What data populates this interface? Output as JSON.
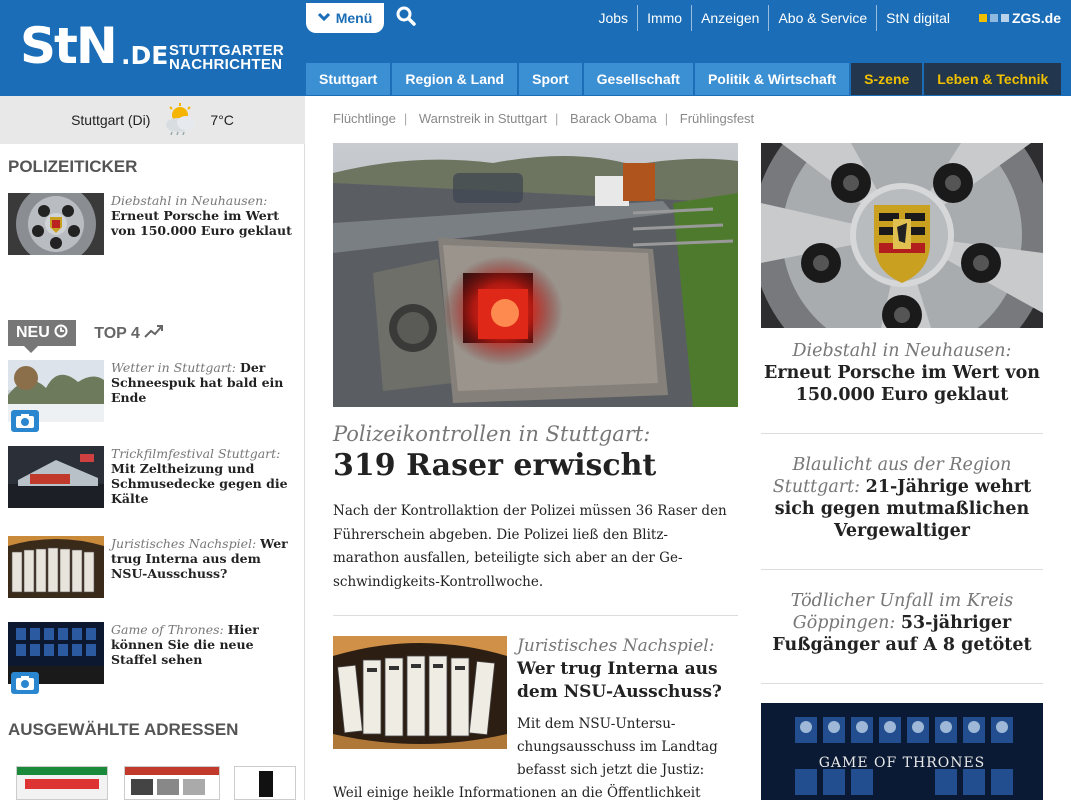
{
  "header": {
    "logo_main": "StN",
    "logo_domain": ".DE",
    "logo_sub_line1": "STUTTGARTER",
    "logo_sub_line2": "NACHRICHTEN",
    "menu_label": "Menü",
    "top_links": [
      "Jobs",
      "Immo",
      "Anzeigen",
      "Abo & Service",
      "StN digital"
    ],
    "zgs_label": "ZGS.de",
    "nav_items": [
      "Stuttgart",
      "Region & Land",
      "Sport",
      "Gesellschaft",
      "Politik & Wirtschaft",
      "S-zene",
      "Leben & Technik"
    ]
  },
  "colors": {
    "brand_blue": "#1a6db6",
    "nav_blue": "#3b8fd3",
    "nav_dark": "#22364e",
    "nav_yellow": "#f0c000"
  },
  "weather": {
    "city": "Stuttgart (Di)",
    "temp": "7°C",
    "icon": "sun-cloud-icon"
  },
  "left": {
    "polizei_title": "POLIZEITICKER",
    "polizei_item": {
      "kicker": "Diebstahl in Neuhausen:",
      "headline": "Erneut Porsche im Wert von 150.000 Euro geklaut"
    },
    "tab_neu": "NEU",
    "tab_top": "TOP 4",
    "list": [
      {
        "kicker": "Wetter in Stuttgart:",
        "headline": "Der Schneespuk hat bald ein Ende",
        "camera": true
      },
      {
        "kicker": "Trickfilmfestival Stuttgart:",
        "headline": "Mit Zeltheizung und Schmusedecke gegen die Kälte",
        "camera": false
      },
      {
        "kicker": "Juristisches Nachspiel:",
        "headline": "Wer trug Interna aus dem NSU-Ausschuss?",
        "camera": false
      },
      {
        "kicker": "Game of Thrones:",
        "headline": "Hier können Sie die neue Staffel sehen",
        "camera": true
      }
    ],
    "adressen_title": "AUSGEWÄHLTE ADRESSEN"
  },
  "middle": {
    "tags": [
      "Flüchtlinge",
      "Warnstreik in Stuttgart",
      "Barack Obama",
      "Frühlingsfest"
    ],
    "hero_kicker": "Polizeikontrollen in Stuttgart:",
    "hero_title": "319 Raser erwischt",
    "hero_teaser": "Nach der Kontrollaktion der Polizei müssen 36 Raser den Führerschein abgeben. Die Polizei ließ den Blitz-marathon ausfallen, beteiligte sich aber an der Ge-schwindigkeits-Kontrollwoche.",
    "second_kicker": "Juristisches Nachspiel:",
    "second_title": "Wer trug Interna aus dem NSU-Ausschuss?",
    "second_teaser_l1": "Mit dem NSU-Untersu-",
    "second_teaser_l2": "chungsausschuss im Landtag",
    "second_teaser_l3": "befasst sich jetzt die Justiz:",
    "second_teaser_l4": "Weil einige heikle Informationen an die Öffentlichkeit"
  },
  "right": {
    "block1_kicker": "Diebstahl in Neuhausen:",
    "block1_headline": "Erneut Porsche im Wert von 150.000 Euro geklaut",
    "block2_kicker": "Blaulicht aus der Region Stuttgart:",
    "block2_headline": "21-Jährige wehrt sich gegen mutmaßlichen Vergewaltiger",
    "block3_kicker": "Tödlicher Unfall im Kreis Göppingen:",
    "block3_headline": "53-jähriger Fußgänger auf A 8 getötet",
    "got_label": "GAME OF THRONES"
  }
}
